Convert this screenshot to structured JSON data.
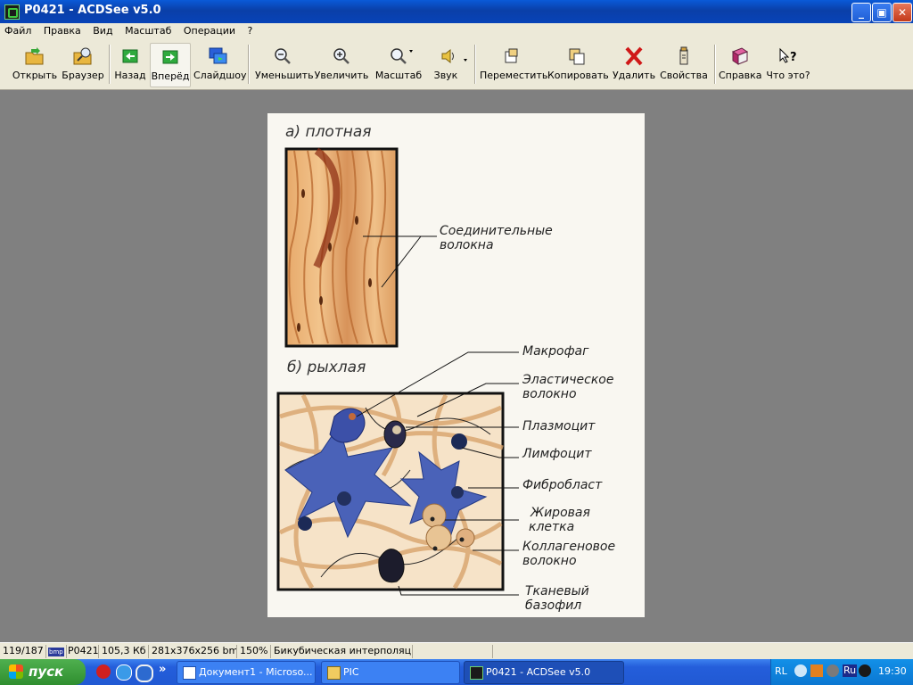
{
  "window": {
    "title": "P0421 - ACDSee v5.0",
    "controls": {
      "minimize": "_",
      "maximize": "▣",
      "close": "✕"
    }
  },
  "menu": [
    "Файл",
    "Правка",
    "Вид",
    "Масштаб",
    "Операции",
    "?"
  ],
  "toolbar": {
    "open": "Открыть",
    "browser": "Браузер",
    "back": "Назад",
    "forward": "Вперёд",
    "slideshow": "Слайдшоу",
    "zoom_out": "Уменьшить",
    "zoom_in": "Увеличить",
    "zoom": "Масштаб",
    "sound": "Звук",
    "move": "Переместить",
    "copy": "Копировать",
    "delete": "Удалить",
    "properties": "Свойства",
    "help": "Справка",
    "whats_this": "Что это?"
  },
  "image": {
    "title_a": "а) плотная",
    "title_b": "б) рыхлая",
    "label_fibers_1": "Соединительные",
    "label_fibers_2": "волокна",
    "label_macrophage": "Макрофаг",
    "label_elastic_1": "Эластическое",
    "label_elastic_2": "волокно",
    "label_plasmocyte": "Плазмоцит",
    "label_lymphocyte": "Лимфоцит",
    "label_fibroblast": "Фибробласт",
    "label_fat_1": "Жировая",
    "label_fat_2": "клетка",
    "label_collagen_1": "Коллагеновое",
    "label_collagen_2": "волокно",
    "label_basophil_1": "Тканевый",
    "label_basophil_2": "базофил"
  },
  "status": {
    "index": "119/187",
    "filetype_icon": "bmp",
    "filename": "P0421",
    "filesize": "105,3 Кб",
    "dimensions": "281x376x256 bmp",
    "zoom": "150%",
    "interpolation": "Бикубическая интерполяция"
  },
  "taskbar": {
    "start": "пуск",
    "more": "»",
    "tasks": [
      "Документ1 - Microso...",
      "PIC",
      "P0421 - ACDSee v5.0"
    ],
    "lang": "RL",
    "lang_ru": "Ru",
    "clock": "19:30"
  }
}
